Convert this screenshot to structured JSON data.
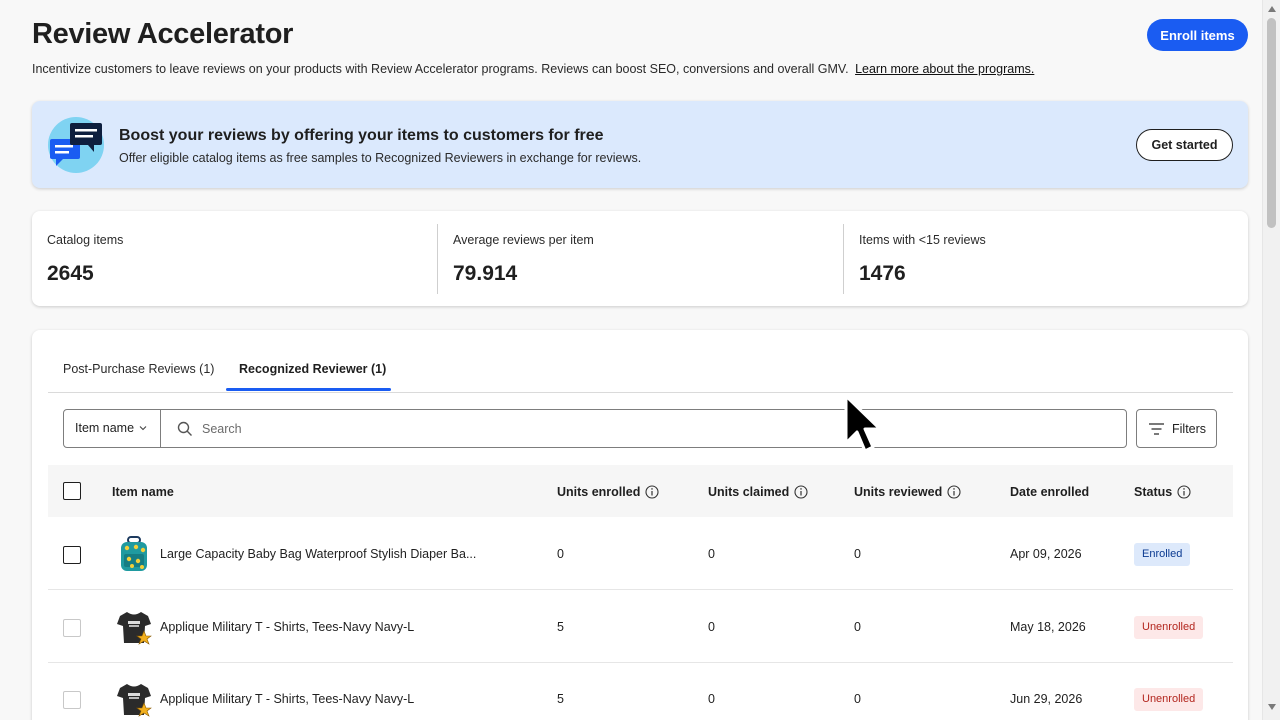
{
  "header": {
    "title": "Review Accelerator",
    "subtitle": "Incentivize customers to leave reviews on your products with Review Accelerator programs. Reviews can boost SEO, conversions and overall GMV.",
    "learn_more": "Learn more about the programs.",
    "enroll_label": "Enroll items"
  },
  "banner": {
    "title": "Boost your reviews by offering your items to customers for free",
    "text": "Offer eligible catalog items as free samples to Recognized Reviewers in exchange for reviews.",
    "button_label": "Get started",
    "icon": "chat-bubbles-icon"
  },
  "stats": [
    {
      "label": "Catalog items",
      "value": "2645"
    },
    {
      "label": "Average reviews per item",
      "value": "79.914"
    },
    {
      "label": "Items with <15 reviews",
      "value": "1476"
    }
  ],
  "tabs": [
    {
      "label": "Post-Purchase Reviews (1)",
      "active": false
    },
    {
      "label": "Recognized Reviewer (1)",
      "active": true
    }
  ],
  "search": {
    "field_select": "Item name",
    "placeholder": "Search",
    "filters_label": "Filters"
  },
  "table": {
    "columns": [
      "Item name",
      "Units enrolled",
      "Units claimed",
      "Units reviewed",
      "Date enrolled",
      "Status"
    ],
    "rows": [
      {
        "name": "Large Capacity Baby Bag Waterproof Stylish Diaper Ba...",
        "enrolled": "0",
        "claimed": "0",
        "reviewed": "0",
        "date": "Apr 09, 2026",
        "status": "Enrolled"
      },
      {
        "name": "Applique Military T - Shirts, Tees-Navy Navy-L",
        "enrolled": "5",
        "claimed": "0",
        "reviewed": "0",
        "date": "May 18, 2026",
        "status": "Unenrolled"
      },
      {
        "name": "Applique Military T - Shirts, Tees-Navy Navy-L",
        "enrolled": "5",
        "claimed": "0",
        "reviewed": "0",
        "date": "Jun 29, 2026",
        "status": "Unenrolled"
      }
    ]
  },
  "colors": {
    "accent": "#1a5cf2",
    "banner_bg": "#dbe9fd",
    "enrolled_bg": "#dde9fb",
    "unenrolled_bg": "#fde8e8"
  }
}
